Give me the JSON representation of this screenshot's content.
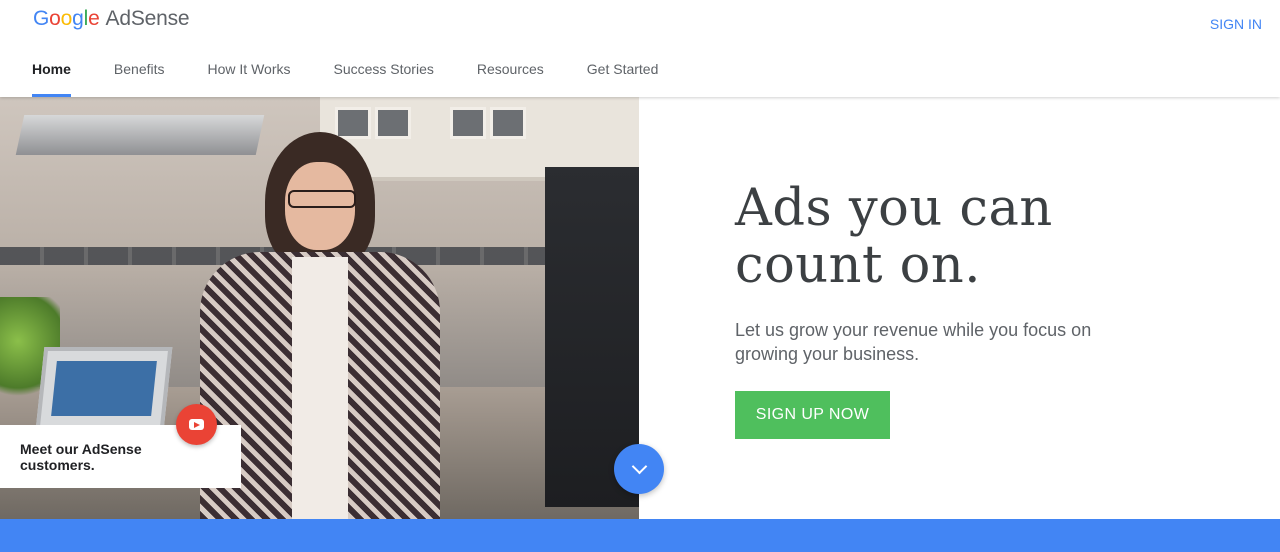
{
  "header": {
    "logo": {
      "google_letters": [
        "G",
        "o",
        "o",
        "g",
        "l",
        "e"
      ],
      "product": "AdSense"
    },
    "sign_in": "SIGN IN",
    "nav": [
      {
        "label": "Home",
        "active": true
      },
      {
        "label": "Benefits",
        "active": false
      },
      {
        "label": "How It Works",
        "active": false
      },
      {
        "label": "Success Stories",
        "active": false
      },
      {
        "label": "Resources",
        "active": false
      },
      {
        "label": "Get Started",
        "active": false
      }
    ]
  },
  "hero": {
    "video_caption": "Meet our AdSense customers.",
    "play_icon": "youtube-play-icon",
    "headline_line1": "Ads you can",
    "headline_line2": "count on.",
    "subtext": "Let us grow your revenue while you focus on growing your business.",
    "cta": "SIGN UP NOW",
    "scroll_icon": "chevron-down-icon"
  },
  "colors": {
    "accent_blue": "#4285f4",
    "cta_green": "#4fbf5d",
    "play_red": "#ea4335",
    "headline_text": "#3c4043"
  }
}
